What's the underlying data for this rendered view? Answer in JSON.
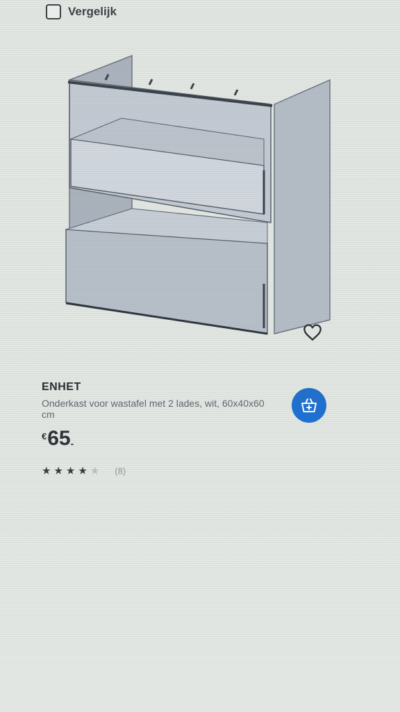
{
  "compare": {
    "label": "Vergelijk",
    "checked": false
  },
  "product": {
    "name": "ENHET",
    "description": "Onderkast voor wastafel met 2 lades, wit, 60x40x60 cm",
    "price": {
      "currency": "€",
      "amount": "65",
      "suffix": "-"
    },
    "rating": {
      "stars": 4,
      "max": 5,
      "reviews": "(8)"
    }
  },
  "icons": {
    "favorite": "heart-icon",
    "cart": "add-to-cart-icon"
  },
  "colors": {
    "accent": "#1d6fd0"
  }
}
